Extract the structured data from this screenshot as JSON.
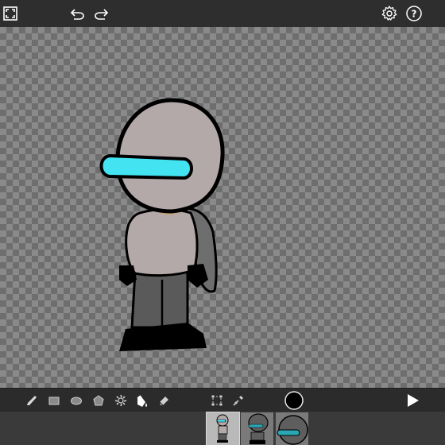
{
  "app": {
    "colors": {
      "topbar": "#2e2e2e",
      "toolbar": "#2b2b2b",
      "framebar": "#3a3a3a",
      "checker_light": "#8a8a8a",
      "checker_dark": "#6e6e6e",
      "visor": "#43e3f2",
      "head": "#b3a9a8",
      "pants": "#5a5a5a",
      "current_color": "#000000"
    }
  },
  "topbar": {
    "icons": [
      "fullscreen-icon",
      "undo-icon",
      "redo-icon",
      "settings-icon",
      "help-icon"
    ],
    "help_glyph": "?"
  },
  "toolbar": {
    "tools": [
      "brush-icon",
      "rectangle-icon",
      "ellipse-icon",
      "polygon-icon",
      "stamp-icon",
      "fill-bucket-icon",
      "eraser-icon",
      "selection-icon",
      "eyedropper-icon",
      "color-swatch",
      "play-icon"
    ],
    "active_tool": "fill-bucket-icon"
  },
  "frames": {
    "count": 3,
    "selected_index": 0
  }
}
